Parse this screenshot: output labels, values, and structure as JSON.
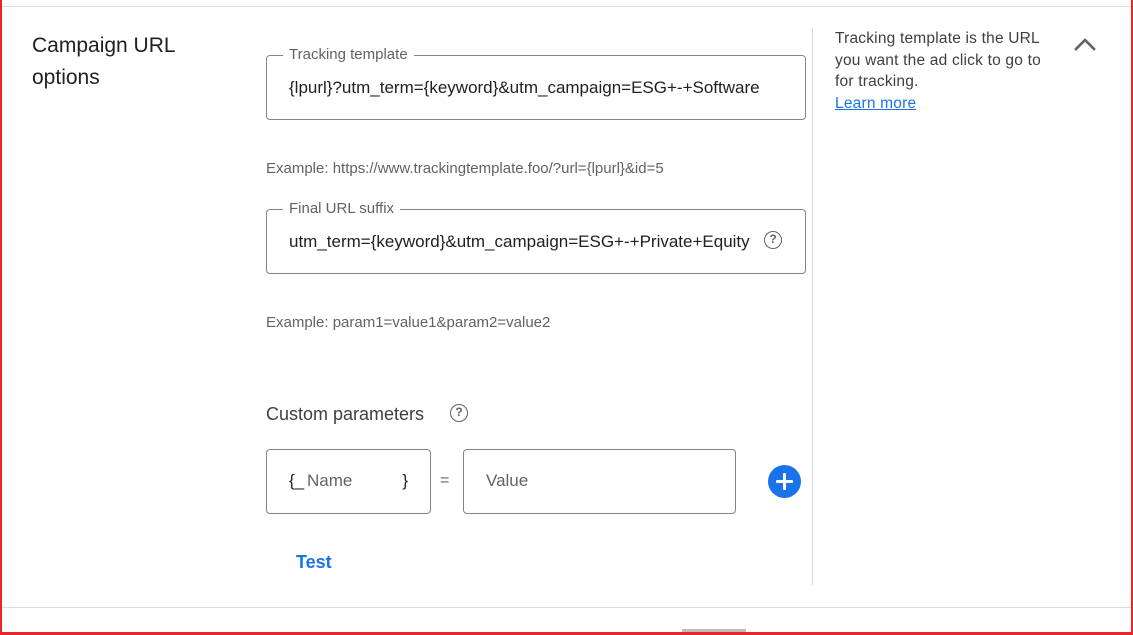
{
  "section": {
    "title": "Campaign URL options"
  },
  "tracking_template": {
    "label": "Tracking template",
    "value": "{lpurl}?utm_term={keyword}&utm_campaign=ESG+-+Software",
    "example": "Example: https://www.trackingtemplate.foo/?url={lpurl}&id=5"
  },
  "final_url_suffix": {
    "label": "Final URL suffix",
    "value": "utm_term={keyword}&utm_campaign=ESG+-+Private+Equity",
    "example": "Example: param1=value1&param2=value2",
    "help_icon": "help-circle-icon"
  },
  "custom_parameters": {
    "label": "Custom parameters",
    "help_icon": "help-circle-icon",
    "name_prefix": "{_",
    "name_suffix": "}",
    "name_placeholder": "Name",
    "equals": "=",
    "value_placeholder": "Value",
    "add_icon": "add-circle-icon"
  },
  "test_button": {
    "label": "Test"
  },
  "info_panel": {
    "text": "Tracking template is the URL you want the ad click to go to for tracking.",
    "link": "Learn more",
    "collapse_icon": "chevron-up-icon"
  },
  "colors": {
    "accent": "#1a73e8",
    "frame": "#e4292a",
    "border": "#80868b",
    "muted_text": "#5f6368"
  }
}
